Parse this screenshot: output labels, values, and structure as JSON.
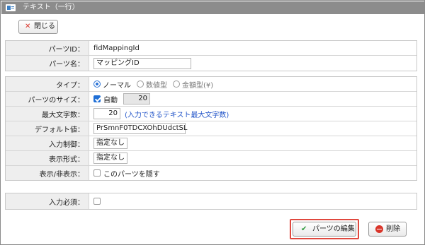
{
  "window": {
    "title": "テキスト（一行）"
  },
  "toolbar": {
    "close_label": "閉じる",
    "close_icon": "x-icon"
  },
  "group1": {
    "parts_id_label": "パーツID：",
    "parts_id_value": "fidMappingId",
    "parts_name_label": "パーツ名：",
    "parts_name_value": "マッピングID"
  },
  "group2": {
    "type_label": "タイプ：",
    "type_options": [
      "ノーマル",
      "数値型",
      "金額型(¥)"
    ],
    "type_selected": "ノーマル",
    "size_label": "パーツのサイズ：",
    "size_auto_label": "自動",
    "size_auto_checked": true,
    "size_value": "20",
    "maxlen_label": "最大文字数：",
    "maxlen_value": "20",
    "maxlen_hint": "(入力できるテキスト最大文字数)",
    "default_label": "デフォルト値：",
    "default_value": "PrSmnF0TDCXOhDUdctSL",
    "input_ctrl_label": "入力制御：",
    "input_ctrl_value": "指定なし",
    "display_fmt_label": "表示形式：",
    "display_fmt_value": "指定なし",
    "visibility_label": "表示/非表示：",
    "visibility_check_label": "このパーツを隠す",
    "visibility_checked": false
  },
  "group3": {
    "required_label": "入力必須：",
    "required_checked": false
  },
  "footer": {
    "edit_label": "パーツの編集",
    "delete_label": "削除"
  },
  "colors": {
    "highlight": "#e0483e",
    "accent": "#2456c9",
    "titlebar": "#8c8c8c"
  }
}
